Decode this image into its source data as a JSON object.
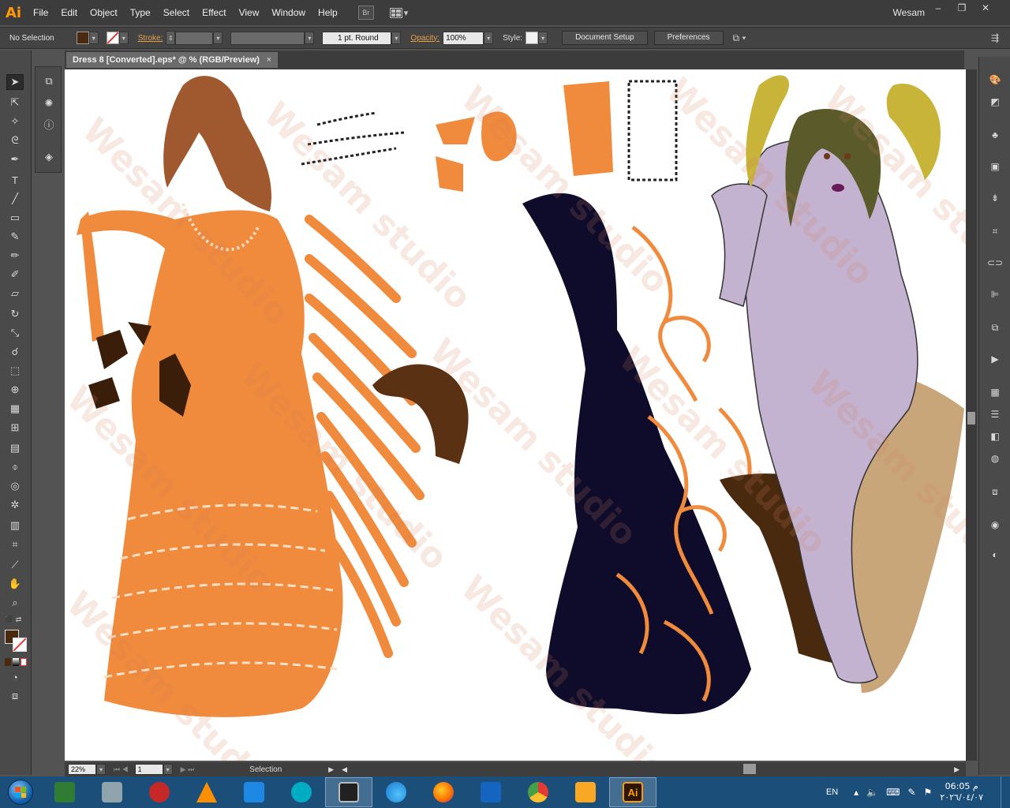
{
  "app": {
    "logo": "Ai",
    "menus": [
      "File",
      "Edit",
      "Object",
      "Type",
      "Select",
      "Effect",
      "View",
      "Window",
      "Help"
    ],
    "bridge_label": "Br",
    "user": "Wesam",
    "window_controls": [
      "–",
      "❐",
      "✕"
    ]
  },
  "control_bar": {
    "selection_status": "No Selection",
    "fill_color": "#4a2a0e",
    "stroke_label": "Stroke:",
    "stroke_profile": "1 pt. Round",
    "opacity_label": "Opacity:",
    "opacity_value": "100%",
    "style_label": "Style:",
    "document_setup": "Document Setup",
    "preferences": "Preferences"
  },
  "document": {
    "tab_title": "Dress 8 [Converted].eps* @ % (RGB/Preview)",
    "close": "×",
    "watermark": "Wesam studio"
  },
  "status_bar": {
    "zoom": "22%",
    "artboard": "1",
    "tool_status": "Selection"
  },
  "tools": [
    "selection-icon",
    "direct-selection-icon",
    "magic-wand-icon",
    "lasso-icon",
    "pen-icon",
    "type-icon",
    "line-icon",
    "rectangle-icon",
    "paintbrush-icon",
    "pencil-icon",
    "blob-brush-icon",
    "eraser-icon",
    "rotate-icon",
    "scale-icon",
    "warp-icon",
    "free-transform-icon",
    "shape-builder-icon",
    "perspective-icon",
    "mesh-icon",
    "gradient-icon",
    "eyedropper-icon",
    "blend-icon",
    "symbol-sprayer-icon",
    "graph-icon",
    "artboard-icon",
    "slice-icon",
    "hand-icon",
    "zoom-icon"
  ],
  "right_panels": [
    "color-icon",
    "color-guide-icon",
    "swatches-icon",
    "brushes-icon",
    "symbols-icon",
    "transform-icon",
    "pathfinder-icon",
    "align-icon",
    "layers-icon",
    "actions-icon",
    "grid-icon",
    "stroke-icon",
    "gradient-panel-icon",
    "transparency-icon",
    "artboards-panel-icon",
    "appearance-icon",
    "graphic-styles-icon"
  ],
  "taskbar": {
    "language": "EN",
    "time": "06:05 م",
    "date": "٢٠٢٦/٠٤/٠٧",
    "apps": [
      {
        "name": "screen-recorder-icon",
        "color": "#2e7d32"
      },
      {
        "name": "paint-tool-icon",
        "color": "#90a4ae"
      },
      {
        "name": "eye-app-icon",
        "color": "#c62828"
      },
      {
        "name": "vlc-icon",
        "color": "#ff8f00"
      },
      {
        "name": "photo-app-icon",
        "color": "#1e88e5"
      },
      {
        "name": "reel-app-icon",
        "color": "#00acc1"
      },
      {
        "name": "studio-app-icon",
        "color": "#212121"
      },
      {
        "name": "edge-icon",
        "color": "#1976d2"
      },
      {
        "name": "firefox-icon",
        "color": "#ff6d00"
      },
      {
        "name": "mail-app-icon",
        "color": "#1565c0"
      },
      {
        "name": "chrome-icon",
        "color": "#43a047"
      },
      {
        "name": "explorer-icon",
        "color": "#f9a825"
      },
      {
        "name": "illustrator-icon",
        "color": "#ff9a00"
      }
    ]
  }
}
